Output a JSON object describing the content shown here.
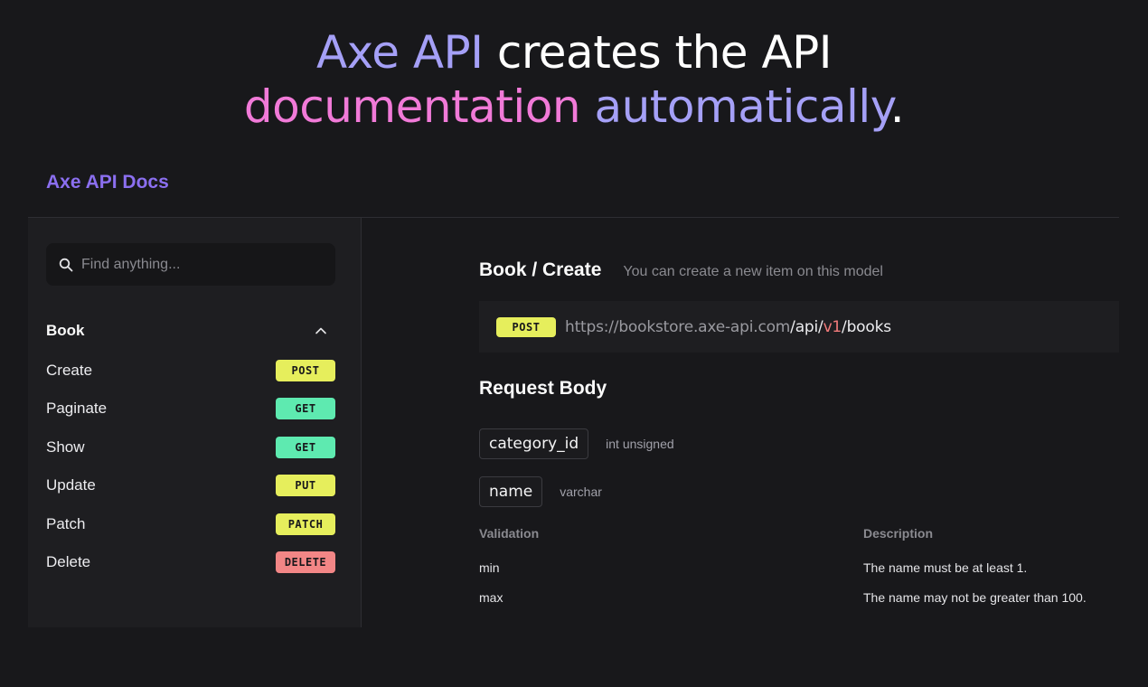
{
  "hero": {
    "line1_highlight": "Axe API",
    "line1_rest": " creates the API",
    "line2_word1": "documentation",
    "line2_word2": "automatically",
    "line2_end": "."
  },
  "brand": "Axe API Docs",
  "search": {
    "placeholder": "Find anything...",
    "value": ""
  },
  "sidebar": {
    "group": {
      "title": "Book",
      "expanded": true
    },
    "items": [
      {
        "label": "Create",
        "method": "POST",
        "color": "#e6ee5c"
      },
      {
        "label": "Paginate",
        "method": "GET",
        "color": "#5eeab0"
      },
      {
        "label": "Show",
        "method": "GET",
        "color": "#5eeab0"
      },
      {
        "label": "Update",
        "method": "PUT",
        "color": "#e6ee5c"
      },
      {
        "label": "Patch",
        "method": "PATCH",
        "color": "#e6ee5c"
      },
      {
        "label": "Delete",
        "method": "DELETE",
        "color": "#f28686"
      }
    ]
  },
  "main": {
    "title": "Book / Create",
    "description": "You can create a new item on this model",
    "endpoint": {
      "method": "POST",
      "host": "https://bookstore.axe-api.com",
      "path1": "/api/",
      "version": "v1",
      "path2": "/books"
    },
    "request_body": {
      "title": "Request Body",
      "fields": [
        {
          "name": "category_id",
          "type": "int unsigned"
        },
        {
          "name": "name",
          "type": "varchar"
        }
      ],
      "validation_header": "Validation",
      "description_header": "Description",
      "rules": [
        {
          "rule": "min",
          "description": "The name must be at least 1."
        },
        {
          "rule": "max",
          "description": "The name may not be greater than 100."
        }
      ]
    }
  },
  "colors": {
    "background": "#18181b",
    "accent_purple": "#a5a0f7",
    "accent_pink": "#f17ad8",
    "brand": "#8b6ff0"
  }
}
